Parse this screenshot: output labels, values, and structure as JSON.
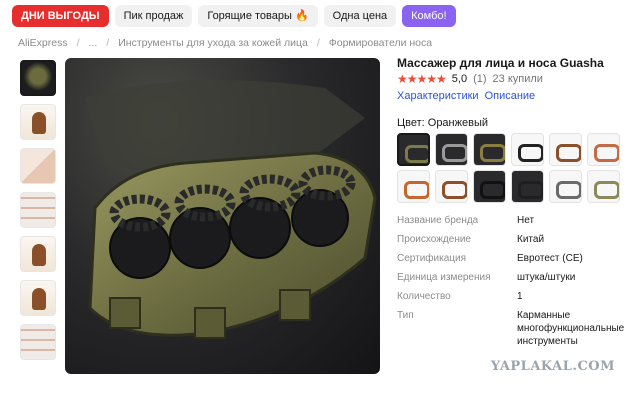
{
  "tabs": [
    "ДНИ ВЫГОДЫ",
    "Пик продаж",
    "Горящие товары",
    "Одна цена",
    "Комбо!"
  ],
  "breadcrumb": [
    "AliExpress",
    "...",
    "Инструменты для ухода за кожей лица",
    "Формирователи носа"
  ],
  "product": {
    "title": "Массажер для лица и носа Guasha",
    "stars": "★★★★★",
    "rating": "5,0",
    "reviews": "(1)",
    "sold": "23 купили",
    "link_specs": "Характеристики",
    "link_description": "Описание",
    "color_label": "Цвет: Оранжевый"
  },
  "colors": {
    "accent_red": "#e62e2e",
    "combo_purple": "#8a63f1",
    "link_blue": "#2a53d8",
    "star_red": "#f04b35"
  },
  "swatch_colors": [
    "#7a7a4a",
    "#9a9a9a",
    "#8a7d3f",
    "#222222",
    "#8b4f2a",
    "#c46b46",
    "#c2672d",
    "#8b4f2a",
    "#111111",
    "#1e1e1e",
    "#6a6a6a",
    "#8c8a5a"
  ],
  "specs": [
    {
      "key": "Название бренда",
      "value": "Нет"
    },
    {
      "key": "Происхождение",
      "value": "Китай"
    },
    {
      "key": "Сертификация",
      "value": "Евротест (CE)"
    },
    {
      "key": "Единица измерения",
      "value": "штука/штуки"
    },
    {
      "key": "Количество",
      "value": "1"
    },
    {
      "key": "Тип",
      "value": "Карманные многофункциональные инструменты"
    }
  ],
  "watermark": "YAPLAKAL.COM"
}
